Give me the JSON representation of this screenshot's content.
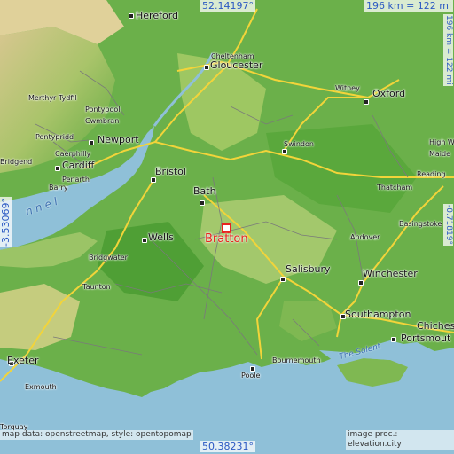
{
  "colors": {
    "sea": "#8fc0d8",
    "land_low": "#3f9a2e",
    "land_mid": "#8cbf5a",
    "land_high": "#d9c98c",
    "road_major": "#f2d43a",
    "road_minor": "#8a8a8a",
    "focus": "#e8231e",
    "coord_text": "#2b59c3"
  },
  "coords": {
    "top_lat": "52.14197°",
    "bottom_lat": "50.38231°",
    "left_lon": "-3.53069°",
    "right_lon": "-0.71819°",
    "scale_top": "196 km = 122 mi",
    "scale_right": "196 km = 122 mi"
  },
  "focus": {
    "name": "Bratton",
    "marker_icon": "square-marker-icon"
  },
  "towns": [
    {
      "id": "hereford",
      "name": "Hereford",
      "size": "big"
    },
    {
      "id": "cheltenham",
      "name": "Cheltenham",
      "size": "sm"
    },
    {
      "id": "gloucester",
      "name": "Gloucester",
      "size": "big"
    },
    {
      "id": "witney",
      "name": "Witney",
      "size": "sm"
    },
    {
      "id": "oxford",
      "name": "Oxford",
      "size": "big"
    },
    {
      "id": "merthyr",
      "name": "Merthyr Tydfil",
      "size": "sm"
    },
    {
      "id": "pontypool",
      "name": "Pontypool",
      "size": "sm"
    },
    {
      "id": "cwmbran",
      "name": "Cwmbran",
      "size": "sm"
    },
    {
      "id": "pontypridd",
      "name": "Pontypridd",
      "size": "sm"
    },
    {
      "id": "newport",
      "name": "Newport",
      "size": "big"
    },
    {
      "id": "caerphilly",
      "name": "Caerphilly",
      "size": "sm"
    },
    {
      "id": "bridgend",
      "name": "Bridgend",
      "size": "sm"
    },
    {
      "id": "cardiff",
      "name": "Cardiff",
      "size": "big"
    },
    {
      "id": "penarth",
      "name": "Penarth",
      "size": "sm"
    },
    {
      "id": "barry",
      "name": "Barry",
      "size": "sm"
    },
    {
      "id": "bristol",
      "name": "Bristol",
      "size": "big"
    },
    {
      "id": "swindon",
      "name": "Swindon",
      "size": "sm"
    },
    {
      "id": "highwycombe",
      "name": "High Wy",
      "size": "sm"
    },
    {
      "id": "maidenhead",
      "name": "Maide",
      "size": "sm"
    },
    {
      "id": "reading",
      "name": "Reading",
      "size": "sm"
    },
    {
      "id": "thatcham",
      "name": "Thatcham",
      "size": "sm"
    },
    {
      "id": "bath",
      "name": "Bath",
      "size": "big"
    },
    {
      "id": "basingstoke",
      "name": "Basingstoke",
      "size": "sm"
    },
    {
      "id": "wells",
      "name": "Wells",
      "size": "big"
    },
    {
      "id": "andover",
      "name": "Andover",
      "size": "sm"
    },
    {
      "id": "bridgwater",
      "name": "Bridgwater",
      "size": "sm"
    },
    {
      "id": "salisbury",
      "name": "Salisbury",
      "size": "big"
    },
    {
      "id": "winchester",
      "name": "Winchester",
      "size": "big"
    },
    {
      "id": "taunton",
      "name": "Taunton",
      "size": "sm"
    },
    {
      "id": "southampton",
      "name": "Southampton",
      "size": "big"
    },
    {
      "id": "chichester",
      "name": "Chiches",
      "size": "big"
    },
    {
      "id": "portsmouth",
      "name": "Portsmout",
      "size": "big"
    },
    {
      "id": "bournemouth",
      "name": "Bournemouth",
      "size": "sm"
    },
    {
      "id": "poole",
      "name": "Poole",
      "size": "sm"
    },
    {
      "id": "exeter",
      "name": "Exeter",
      "size": "big"
    },
    {
      "id": "exmouth",
      "name": "Exmouth",
      "size": "sm"
    },
    {
      "id": "torquay",
      "name": "Torquay",
      "size": "sm"
    }
  ],
  "waters": [
    {
      "id": "channel",
      "name": "n n e l"
    },
    {
      "id": "solent",
      "name": "The Solent"
    }
  ],
  "credits": {
    "left": "map data: openstreetmap, style: opentopomap",
    "right": "image proc.: elevation.city"
  }
}
